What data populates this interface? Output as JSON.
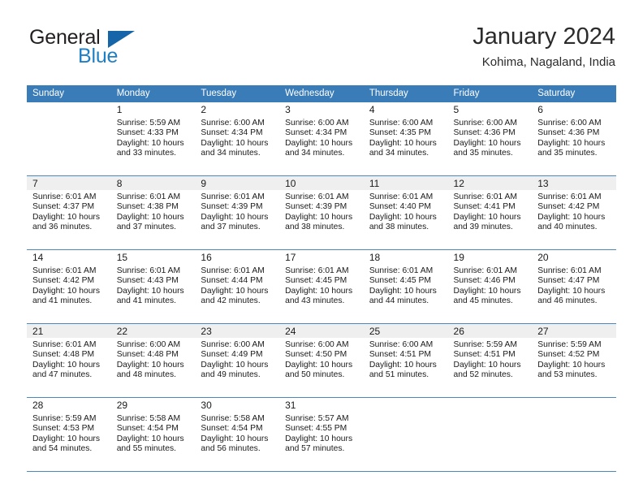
{
  "brand": {
    "name_part1": "General",
    "name_part2": "Blue",
    "accent_color": "#1565a8"
  },
  "header": {
    "title": "January 2024",
    "subtitle": "Kohima, Nagaland, India"
  },
  "calendar": {
    "header_bg": "#3a7cb8",
    "weekday_headers": [
      "Sunday",
      "Monday",
      "Tuesday",
      "Wednesday",
      "Thursday",
      "Friday",
      "Saturday"
    ],
    "weeks": [
      {
        "shaded": false,
        "days": [
          {
            "empty": true,
            "num": "",
            "sunrise": "",
            "sunset": "",
            "daylight1": "",
            "daylight2": ""
          },
          {
            "empty": false,
            "num": "1",
            "sunrise": "Sunrise: 5:59 AM",
            "sunset": "Sunset: 4:33 PM",
            "daylight1": "Daylight: 10 hours",
            "daylight2": "and 33 minutes."
          },
          {
            "empty": false,
            "num": "2",
            "sunrise": "Sunrise: 6:00 AM",
            "sunset": "Sunset: 4:34 PM",
            "daylight1": "Daylight: 10 hours",
            "daylight2": "and 34 minutes."
          },
          {
            "empty": false,
            "num": "3",
            "sunrise": "Sunrise: 6:00 AM",
            "sunset": "Sunset: 4:34 PM",
            "daylight1": "Daylight: 10 hours",
            "daylight2": "and 34 minutes."
          },
          {
            "empty": false,
            "num": "4",
            "sunrise": "Sunrise: 6:00 AM",
            "sunset": "Sunset: 4:35 PM",
            "daylight1": "Daylight: 10 hours",
            "daylight2": "and 34 minutes."
          },
          {
            "empty": false,
            "num": "5",
            "sunrise": "Sunrise: 6:00 AM",
            "sunset": "Sunset: 4:36 PM",
            "daylight1": "Daylight: 10 hours",
            "daylight2": "and 35 minutes."
          },
          {
            "empty": false,
            "num": "6",
            "sunrise": "Sunrise: 6:00 AM",
            "sunset": "Sunset: 4:36 PM",
            "daylight1": "Daylight: 10 hours",
            "daylight2": "and 35 minutes."
          }
        ]
      },
      {
        "shaded": true,
        "days": [
          {
            "empty": false,
            "num": "7",
            "sunrise": "Sunrise: 6:01 AM",
            "sunset": "Sunset: 4:37 PM",
            "daylight1": "Daylight: 10 hours",
            "daylight2": "and 36 minutes."
          },
          {
            "empty": false,
            "num": "8",
            "sunrise": "Sunrise: 6:01 AM",
            "sunset": "Sunset: 4:38 PM",
            "daylight1": "Daylight: 10 hours",
            "daylight2": "and 37 minutes."
          },
          {
            "empty": false,
            "num": "9",
            "sunrise": "Sunrise: 6:01 AM",
            "sunset": "Sunset: 4:39 PM",
            "daylight1": "Daylight: 10 hours",
            "daylight2": "and 37 minutes."
          },
          {
            "empty": false,
            "num": "10",
            "sunrise": "Sunrise: 6:01 AM",
            "sunset": "Sunset: 4:39 PM",
            "daylight1": "Daylight: 10 hours",
            "daylight2": "and 38 minutes."
          },
          {
            "empty": false,
            "num": "11",
            "sunrise": "Sunrise: 6:01 AM",
            "sunset": "Sunset: 4:40 PM",
            "daylight1": "Daylight: 10 hours",
            "daylight2": "and 38 minutes."
          },
          {
            "empty": false,
            "num": "12",
            "sunrise": "Sunrise: 6:01 AM",
            "sunset": "Sunset: 4:41 PM",
            "daylight1": "Daylight: 10 hours",
            "daylight2": "and 39 minutes."
          },
          {
            "empty": false,
            "num": "13",
            "sunrise": "Sunrise: 6:01 AM",
            "sunset": "Sunset: 4:42 PM",
            "daylight1": "Daylight: 10 hours",
            "daylight2": "and 40 minutes."
          }
        ]
      },
      {
        "shaded": false,
        "days": [
          {
            "empty": false,
            "num": "14",
            "sunrise": "Sunrise: 6:01 AM",
            "sunset": "Sunset: 4:42 PM",
            "daylight1": "Daylight: 10 hours",
            "daylight2": "and 41 minutes."
          },
          {
            "empty": false,
            "num": "15",
            "sunrise": "Sunrise: 6:01 AM",
            "sunset": "Sunset: 4:43 PM",
            "daylight1": "Daylight: 10 hours",
            "daylight2": "and 41 minutes."
          },
          {
            "empty": false,
            "num": "16",
            "sunrise": "Sunrise: 6:01 AM",
            "sunset": "Sunset: 4:44 PM",
            "daylight1": "Daylight: 10 hours",
            "daylight2": "and 42 minutes."
          },
          {
            "empty": false,
            "num": "17",
            "sunrise": "Sunrise: 6:01 AM",
            "sunset": "Sunset: 4:45 PM",
            "daylight1": "Daylight: 10 hours",
            "daylight2": "and 43 minutes."
          },
          {
            "empty": false,
            "num": "18",
            "sunrise": "Sunrise: 6:01 AM",
            "sunset": "Sunset: 4:45 PM",
            "daylight1": "Daylight: 10 hours",
            "daylight2": "and 44 minutes."
          },
          {
            "empty": false,
            "num": "19",
            "sunrise": "Sunrise: 6:01 AM",
            "sunset": "Sunset: 4:46 PM",
            "daylight1": "Daylight: 10 hours",
            "daylight2": "and 45 minutes."
          },
          {
            "empty": false,
            "num": "20",
            "sunrise": "Sunrise: 6:01 AM",
            "sunset": "Sunset: 4:47 PM",
            "daylight1": "Daylight: 10 hours",
            "daylight2": "and 46 minutes."
          }
        ]
      },
      {
        "shaded": true,
        "days": [
          {
            "empty": false,
            "num": "21",
            "sunrise": "Sunrise: 6:01 AM",
            "sunset": "Sunset: 4:48 PM",
            "daylight1": "Daylight: 10 hours",
            "daylight2": "and 47 minutes."
          },
          {
            "empty": false,
            "num": "22",
            "sunrise": "Sunrise: 6:00 AM",
            "sunset": "Sunset: 4:48 PM",
            "daylight1": "Daylight: 10 hours",
            "daylight2": "and 48 minutes."
          },
          {
            "empty": false,
            "num": "23",
            "sunrise": "Sunrise: 6:00 AM",
            "sunset": "Sunset: 4:49 PM",
            "daylight1": "Daylight: 10 hours",
            "daylight2": "and 49 minutes."
          },
          {
            "empty": false,
            "num": "24",
            "sunrise": "Sunrise: 6:00 AM",
            "sunset": "Sunset: 4:50 PM",
            "daylight1": "Daylight: 10 hours",
            "daylight2": "and 50 minutes."
          },
          {
            "empty": false,
            "num": "25",
            "sunrise": "Sunrise: 6:00 AM",
            "sunset": "Sunset: 4:51 PM",
            "daylight1": "Daylight: 10 hours",
            "daylight2": "and 51 minutes."
          },
          {
            "empty": false,
            "num": "26",
            "sunrise": "Sunrise: 5:59 AM",
            "sunset": "Sunset: 4:51 PM",
            "daylight1": "Daylight: 10 hours",
            "daylight2": "and 52 minutes."
          },
          {
            "empty": false,
            "num": "27",
            "sunrise": "Sunrise: 5:59 AM",
            "sunset": "Sunset: 4:52 PM",
            "daylight1": "Daylight: 10 hours",
            "daylight2": "and 53 minutes."
          }
        ]
      },
      {
        "shaded": false,
        "days": [
          {
            "empty": false,
            "num": "28",
            "sunrise": "Sunrise: 5:59 AM",
            "sunset": "Sunset: 4:53 PM",
            "daylight1": "Daylight: 10 hours",
            "daylight2": "and 54 minutes."
          },
          {
            "empty": false,
            "num": "29",
            "sunrise": "Sunrise: 5:58 AM",
            "sunset": "Sunset: 4:54 PM",
            "daylight1": "Daylight: 10 hours",
            "daylight2": "and 55 minutes."
          },
          {
            "empty": false,
            "num": "30",
            "sunrise": "Sunrise: 5:58 AM",
            "sunset": "Sunset: 4:54 PM",
            "daylight1": "Daylight: 10 hours",
            "daylight2": "and 56 minutes."
          },
          {
            "empty": false,
            "num": "31",
            "sunrise": "Sunrise: 5:57 AM",
            "sunset": "Sunset: 4:55 PM",
            "daylight1": "Daylight: 10 hours",
            "daylight2": "and 57 minutes."
          },
          {
            "empty": true,
            "num": "",
            "sunrise": "",
            "sunset": "",
            "daylight1": "",
            "daylight2": ""
          },
          {
            "empty": true,
            "num": "",
            "sunrise": "",
            "sunset": "",
            "daylight1": "",
            "daylight2": ""
          },
          {
            "empty": true,
            "num": "",
            "sunrise": "",
            "sunset": "",
            "daylight1": "",
            "daylight2": ""
          }
        ]
      }
    ]
  }
}
